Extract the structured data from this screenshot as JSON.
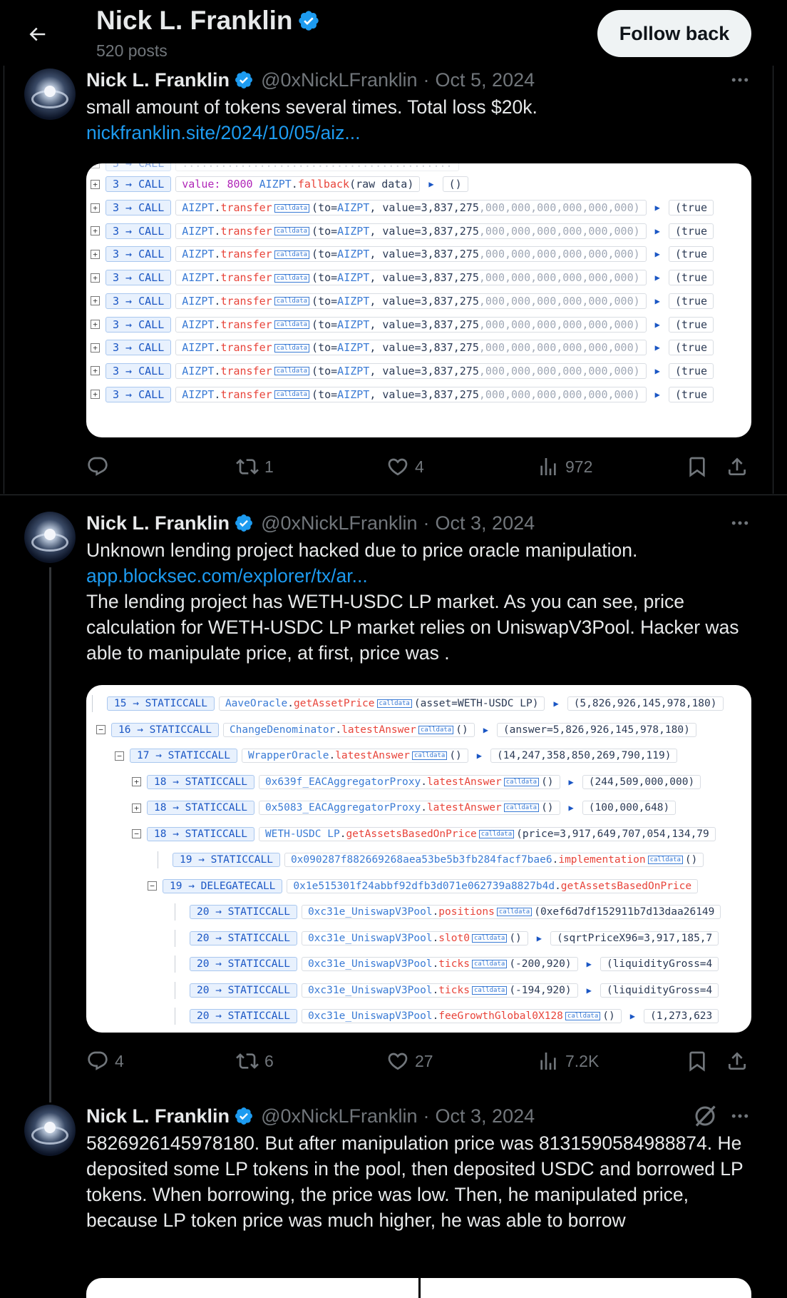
{
  "header": {
    "name": "Nick L. Franklin",
    "posts": "520 posts",
    "follow_label": "Follow back"
  },
  "tweets": [
    {
      "name": "Nick L. Franklin",
      "handle": "@0xNickLFranklin",
      "separator": "·",
      "date": "Oct 5, 2024",
      "text": "small amount of tokens several times. Total loss $20k.",
      "link": "nickfranklin.site/2024/10/05/aiz...",
      "stats": {
        "replies": "",
        "reposts": "1",
        "likes": "4",
        "views": "972"
      }
    },
    {
      "name": "Nick L. Franklin",
      "handle": "@0xNickLFranklin",
      "separator": "·",
      "date": "Oct 3, 2024",
      "text": "Unknown lending project hacked due to price oracle manipulation.",
      "link": "app.blocksec.com/explorer/tx/ar...",
      "text2": "The lending project has WETH-USDC LP market. As you can see, price calculation for WETH-USDC LP market relies on UniswapV3Pool. Hacker was able to manipulate price, at first, price was .",
      "stats": {
        "replies": "4",
        "reposts": "6",
        "likes": "27",
        "views": "7.2K"
      }
    },
    {
      "name": "Nick L. Franklin",
      "handle": "@0xNickLFranklin",
      "separator": "·",
      "date": "Oct 3, 2024",
      "text": "5826926145978180. But after manipulation price was 8131590584988874. He deposited some LP tokens in the pool, then deposited USDC and borrowed LP tokens. When borrowing, the price was low. Then, he manipulated price, because LP token price was much higher, he was able to borrow"
    }
  ],
  "trace1": {
    "first": {
      "depth": "3",
      "call": "CALL",
      "value_label": "value:",
      "value": "8000",
      "contract": "AIZPT",
      "fn": "fallback",
      "args": "(raw data)",
      "ret": "()"
    },
    "rows": [
      {
        "depth": "3",
        "call": "CALL",
        "contract": "AIZPT",
        "fn": "transfer",
        "tag": "calldata",
        "args_a": "(to=",
        "to": "AIZPT",
        "args_b": ", value=3,837,275",
        "args_c": ",000,000,000,000,000,000)",
        "ret": "(true"
      },
      {
        "depth": "3",
        "call": "CALL",
        "contract": "AIZPT",
        "fn": "transfer",
        "tag": "calldata",
        "args_a": "(to=",
        "to": "AIZPT",
        "args_b": ", value=3,837,275",
        "args_c": ",000,000,000,000,000,000)",
        "ret": "(true"
      },
      {
        "depth": "3",
        "call": "CALL",
        "contract": "AIZPT",
        "fn": "transfer",
        "tag": "calldata",
        "args_a": "(to=",
        "to": "AIZPT",
        "args_b": ", value=3,837,275",
        "args_c": ",000,000,000,000,000,000)",
        "ret": "(true"
      },
      {
        "depth": "3",
        "call": "CALL",
        "contract": "AIZPT",
        "fn": "transfer",
        "tag": "calldata",
        "args_a": "(to=",
        "to": "AIZPT",
        "args_b": ", value=3,837,275",
        "args_c": ",000,000,000,000,000,000)",
        "ret": "(true"
      },
      {
        "depth": "3",
        "call": "CALL",
        "contract": "AIZPT",
        "fn": "transfer",
        "tag": "calldata",
        "args_a": "(to=",
        "to": "AIZPT",
        "args_b": ", value=3,837,275",
        "args_c": ",000,000,000,000,000,000)",
        "ret": "(true"
      },
      {
        "depth": "3",
        "call": "CALL",
        "contract": "AIZPT",
        "fn": "transfer",
        "tag": "calldata",
        "args_a": "(to=",
        "to": "AIZPT",
        "args_b": ", value=3,837,275",
        "args_c": ",000,000,000,000,000,000)",
        "ret": "(true"
      },
      {
        "depth": "3",
        "call": "CALL",
        "contract": "AIZPT",
        "fn": "transfer",
        "tag": "calldata",
        "args_a": "(to=",
        "to": "AIZPT",
        "args_b": ", value=3,837,275",
        "args_c": ",000,000,000,000,000,000)",
        "ret": "(true"
      },
      {
        "depth": "3",
        "call": "CALL",
        "contract": "AIZPT",
        "fn": "transfer",
        "tag": "calldata",
        "args_a": "(to=",
        "to": "AIZPT",
        "args_b": ", value=3,837,275",
        "args_c": ",000,000,000,000,000,000)",
        "ret": "(true"
      },
      {
        "depth": "3",
        "call": "CALL",
        "contract": "AIZPT",
        "fn": "transfer",
        "tag": "calldata",
        "args_a": "(to=",
        "to": "AIZPT",
        "args_b": ", value=3,837,275",
        "args_c": ",000,000,000,000,000,000)",
        "ret": "(true"
      }
    ]
  },
  "trace2": {
    "rows": [
      {
        "depth": "15",
        "call": "STATICCALL",
        "contract": "AaveOracle",
        "fn": "getAssetPrice",
        "tag": "calldata",
        "args": "(asset=WETH-USDC LP)",
        "ret": "(5,826,926,145,978,180)"
      },
      {
        "depth": "16",
        "call": "STATICCALL",
        "contract": "ChangeDenominator",
        "fn": "latestAnswer",
        "tag": "calldata",
        "args": "()",
        "ret": "(answer=5,826,926,145,978,180)"
      },
      {
        "depth": "17",
        "call": "STATICCALL",
        "contract": "WrapperOracle",
        "fn": "latestAnswer",
        "tag": "calldata",
        "args": "()",
        "ret": "(14,247,358,850,269,790,119)"
      },
      {
        "depth": "18",
        "call": "STATICCALL",
        "contract": "0x639f_EACAggregatorProxy",
        "fn": "latestAnswer",
        "tag": "calldata",
        "args": "()",
        "ret": "(244,509,000,000)"
      },
      {
        "depth": "18",
        "call": "STATICCALL",
        "contract": "0x5083_EACAggregatorProxy",
        "fn": "latestAnswer",
        "tag": "calldata",
        "args": "()",
        "ret": "(100,000,648)"
      },
      {
        "depth": "18",
        "call": "STATICCALL",
        "contract": "WETH-USDC LP",
        "fn": "getAssetsBasedOnPrice",
        "tag": "calldata",
        "args": "(price=3,917,649,707,054,134,79",
        "ret": ""
      },
      {
        "depth": "19",
        "call": "STATICCALL",
        "contract": "0x090287f882669268aea53be5b3fb284facf7bae6",
        "fn": "implementation",
        "tag": "calldata",
        "args": "()",
        "ret": ""
      },
      {
        "depth": "19",
        "call": "DELEGATECALL",
        "contract": "0x1e515301f24abbf92dfb3d071e062739a8827b4d",
        "fn": "getAssetsBasedOnPrice",
        "tag": "",
        "args": "",
        "ret": ""
      },
      {
        "depth": "20",
        "call": "STATICCALL",
        "contract": "0xc31e_UniswapV3Pool",
        "fn": "positions",
        "tag": "calldata",
        "args": "(0xef6d7df152911b7d13daa26149",
        "ret": ""
      },
      {
        "depth": "20",
        "call": "STATICCALL",
        "contract": "0xc31e_UniswapV3Pool",
        "fn": "slot0",
        "tag": "calldata",
        "args": "()",
        "ret": "(sqrtPriceX96=3,917,185,7"
      },
      {
        "depth": "20",
        "call": "STATICCALL",
        "contract": "0xc31e_UniswapV3Pool",
        "fn": "ticks",
        "tag": "calldata",
        "args": "(-200,920)",
        "ret": "(liquidityGross=4"
      },
      {
        "depth": "20",
        "call": "STATICCALL",
        "contract": "0xc31e_UniswapV3Pool",
        "fn": "ticks",
        "tag": "calldata",
        "args": "(-194,920)",
        "ret": "(liquidityGross=4"
      },
      {
        "depth": "20",
        "call": "STATICCALL",
        "contract": "0xc31e_UniswapV3Pool",
        "fn": "feeGrowthGlobal0X128",
        "tag": "calldata",
        "args": "()",
        "ret": "(1,273,623"
      }
    ]
  },
  "icons": {
    "back": "arrow-left-icon",
    "verified": "verified-badge-icon",
    "more": "more-dots-icon",
    "reply": "reply-icon",
    "repost": "repost-icon",
    "like": "heart-icon",
    "views": "views-chart-icon",
    "bookmark": "bookmark-icon",
    "share": "share-icon",
    "grok": "grok-icon"
  },
  "colors": {
    "accent": "#1d9bf0",
    "background": "#000000",
    "text": "#e7e9ea",
    "muted": "#71767b"
  }
}
